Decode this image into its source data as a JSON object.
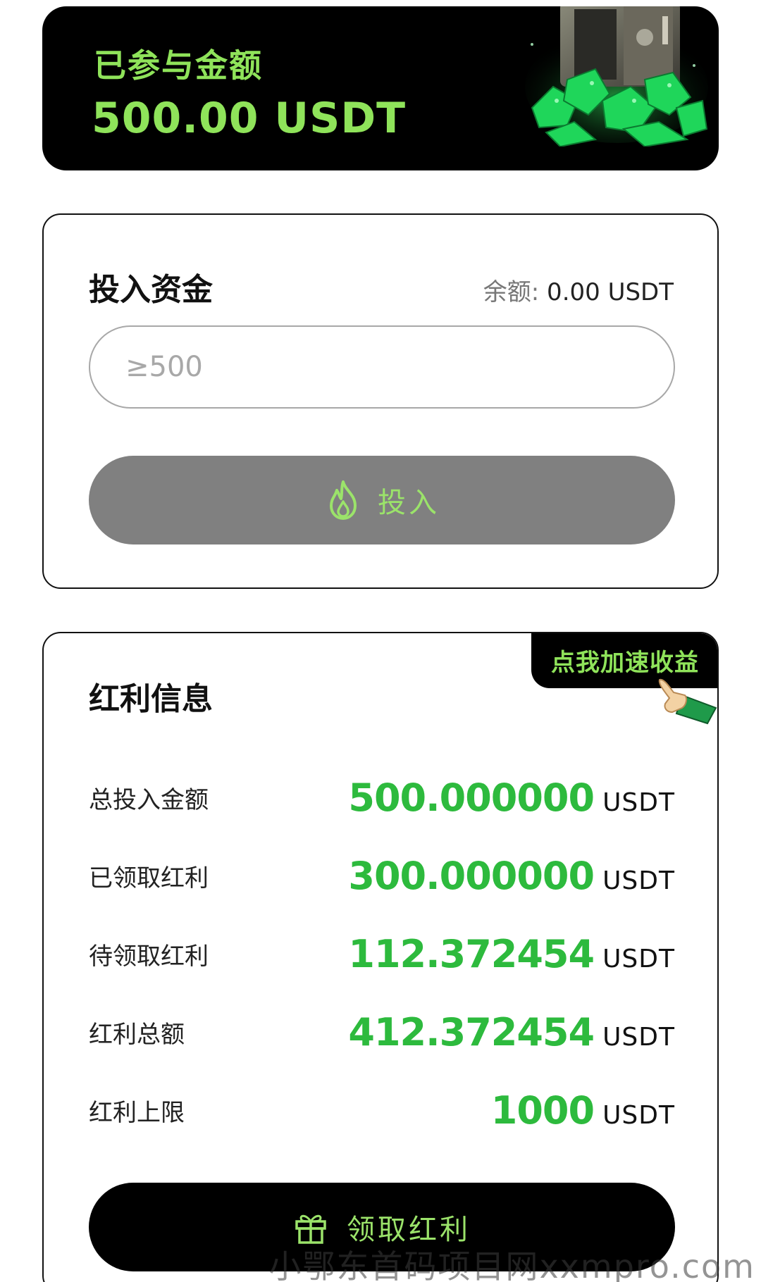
{
  "banner": {
    "label": "已参与金额",
    "amount": "500.00 USDT"
  },
  "invest": {
    "title": "投入资金",
    "balance_label": "余额:",
    "balance_value": " 0.00 USDT",
    "input_placeholder": "≥500",
    "button_label": "投入"
  },
  "bonus": {
    "title": "红利信息",
    "ribbon_label": "点我加速收益",
    "rows": [
      {
        "label": "总投入金额",
        "value": "500.000000",
        "unit": "USDT"
      },
      {
        "label": "已领取红利",
        "value": "300.000000",
        "unit": "USDT"
      },
      {
        "label": "待领取红利",
        "value": "112.372454",
        "unit": "USDT"
      },
      {
        "label": "红利总额",
        "value": "412.372454",
        "unit": "USDT"
      },
      {
        "label": "红利上限",
        "value": "1000",
        "unit": "USDT"
      }
    ],
    "claim_button_label": "领取红利"
  },
  "colors": {
    "accent_green": "#8fe35a",
    "value_green": "#2dba3d",
    "button_gray": "#808080"
  },
  "icons": {
    "invest_button": "fire-icon",
    "claim_button": "gift-icon",
    "ribbon": "pointing-hand-icon",
    "banner": "safe-with-gems-illustration"
  },
  "watermark": "小鄂东首码项目网xxmpro.com"
}
